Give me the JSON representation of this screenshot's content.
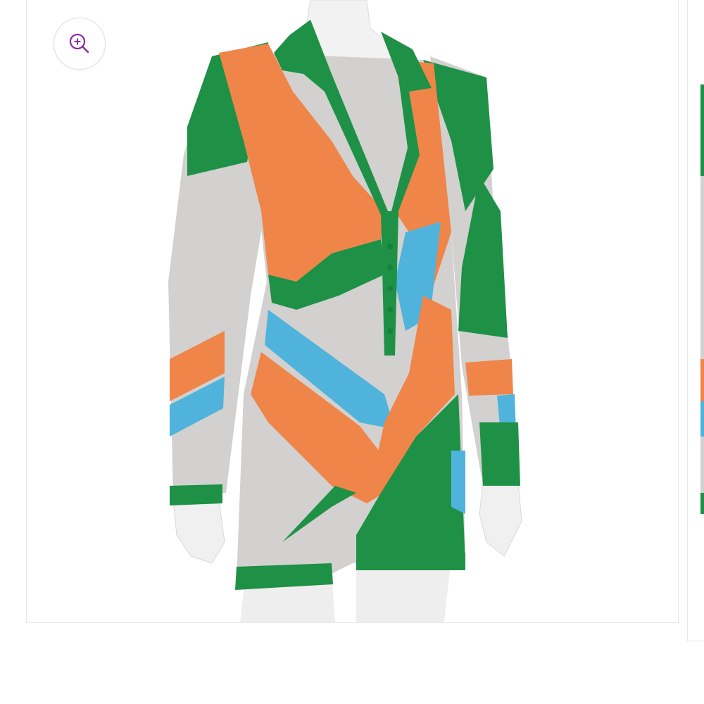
{
  "gallery": {
    "zoom_icon": "zoom-in-icon",
    "accent_color": "#8e2aa8",
    "garment_colors": {
      "green": "#1e9146",
      "orange": "#f0854a",
      "blue": "#4fb3dc",
      "gray": "#d2d1cf"
    }
  }
}
